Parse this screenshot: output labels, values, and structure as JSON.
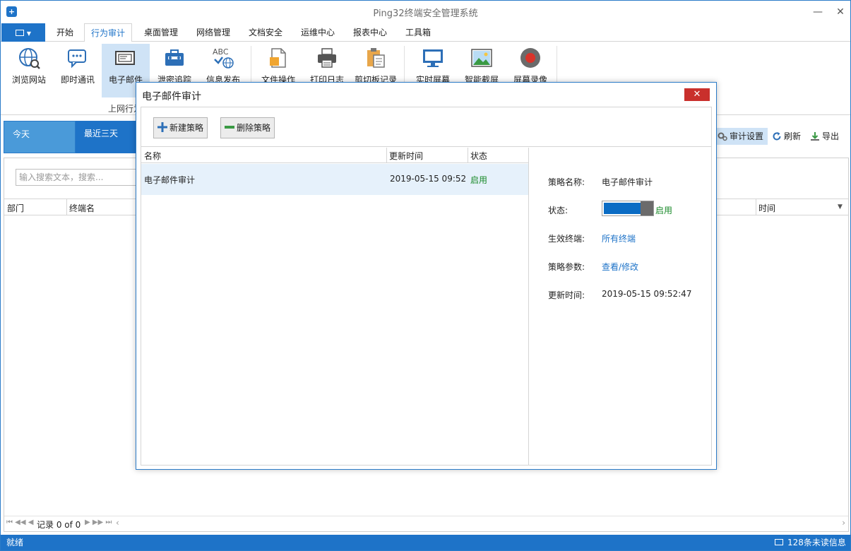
{
  "window": {
    "title": "Ping32终端安全管理系统",
    "minimize_label": "—",
    "maximize_label": "☐",
    "close_label": "✕"
  },
  "ribbon_tabs": [
    {
      "label": "开始"
    },
    {
      "label": "行为审计",
      "active": true
    },
    {
      "label": "桌面管理"
    },
    {
      "label": "网络管理"
    },
    {
      "label": "文档安全"
    },
    {
      "label": "运维中心"
    },
    {
      "label": "报表中心"
    },
    {
      "label": "工具箱"
    }
  ],
  "ribbon": {
    "buttons": [
      {
        "label": "浏览网站",
        "icon": "globe-icon"
      },
      {
        "label": "即时通讯",
        "icon": "chat-icon"
      },
      {
        "label": "电子邮件",
        "icon": "mail-icon",
        "selected": true
      },
      {
        "label": "泄密追踪",
        "icon": "briefcase-icon"
      },
      {
        "label": "信息发布",
        "icon": "abc-globe-icon"
      },
      {
        "label": "文件操作",
        "icon": "file-icon"
      },
      {
        "label": "打印日志",
        "icon": "printer-icon"
      },
      {
        "label": "剪切板记录",
        "icon": "clipboard-icon"
      },
      {
        "label": "实时屏幕",
        "icon": "monitor-icon"
      },
      {
        "label": "智能截屏",
        "icon": "image-icon"
      },
      {
        "label": "屏幕录像",
        "icon": "record-icon"
      }
    ],
    "group_label": "上网行为"
  },
  "datebar": {
    "tabs": [
      {
        "label": "今天"
      },
      {
        "label": "最近三天"
      }
    ]
  },
  "toolbar_right": {
    "audit_settings": "审计设置",
    "refresh": "刷新",
    "export": "导出"
  },
  "grid": {
    "search_placeholder": "输入搜索文本，搜索...",
    "columns": [
      "部门",
      "终端名",
      "时间"
    ],
    "pager_text": "记录 0 of 0"
  },
  "statusbar": {
    "left": "就绪",
    "right": "128条未读信息"
  },
  "dialog": {
    "title": "电子邮件审计",
    "close_label": "✕",
    "new_policy": "新建策略",
    "delete_policy": "删除策略",
    "list_columns": [
      "名称",
      "更新时间",
      "状态"
    ],
    "rows": [
      {
        "name": "电子邮件审计",
        "updated": "2019-05-15 09:52",
        "status": "启用"
      }
    ],
    "detail": {
      "name_label": "策略名称:",
      "name_value": "电子邮件审计",
      "status_label": "状态:",
      "status_value": "启用",
      "terminal_label": "生效终端:",
      "terminal_value": "所有终端",
      "params_label": "策略参数:",
      "params_value": "查看/修改",
      "updated_label": "更新时间:",
      "updated_value": "2019-05-15 09:52:47"
    }
  },
  "colors": {
    "accent": "#1e73c8",
    "selected": "#cfe3f6",
    "enabled_text": "#1a8a2a",
    "close_red": "#c9302c"
  }
}
